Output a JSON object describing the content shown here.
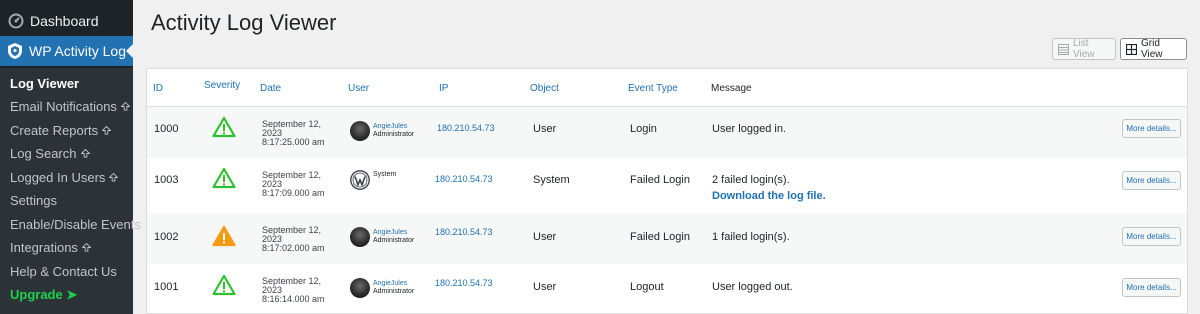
{
  "sidebar": {
    "dashboard_label": "Dashboard",
    "plugin_label": "WP Activity Log",
    "items": [
      {
        "label": "Log Viewer"
      },
      {
        "label": "Email Notifications"
      },
      {
        "label": "Create Reports"
      },
      {
        "label": "Log Search"
      },
      {
        "label": "Logged In Users"
      },
      {
        "label": "Settings"
      },
      {
        "label": "Enable/Disable Events"
      },
      {
        "label": "Integrations"
      },
      {
        "label": "Help & Contact Us"
      },
      {
        "label": "Upgrade ➤"
      }
    ]
  },
  "page": {
    "title": "Activity Log Viewer",
    "list_view_label": "List View",
    "grid_view_label": "Grid View"
  },
  "table": {
    "headers": [
      "ID",
      "Severity",
      "Date",
      "User",
      "IP",
      "Object",
      "Event Type",
      "Message"
    ],
    "more_label": "More details...",
    "rows": [
      {
        "id": "1000",
        "severity": "low",
        "date1": "September 12,",
        "date2": "2023",
        "time": "8:17:25.000 am",
        "user": "AngieJules",
        "role": "Administrator",
        "ip": "180.210.54.73",
        "object": "User",
        "event": "Login",
        "message": "User logged in.",
        "link": ""
      },
      {
        "id": "1003",
        "severity": "low",
        "date1": "September 12,",
        "date2": "2023",
        "time": "8:17:09.000 am",
        "user": "System",
        "role": "",
        "ip": "180.210.54.73",
        "object": "System",
        "event": "Failed Login",
        "message": "2 failed login(s).",
        "link": "Download the log file."
      },
      {
        "id": "1002",
        "severity": "medium",
        "date1": "September 12,",
        "date2": "2023",
        "time": "8:17:02.000 am",
        "user": "AngieJules",
        "role": "Administrator",
        "ip": "180.210.54.73",
        "object": "User",
        "event": "Failed Login",
        "message": "1 failed login(s).",
        "link": ""
      },
      {
        "id": "1001",
        "severity": "low",
        "date1": "September 12,",
        "date2": "2023",
        "time": "8:16:14.000 am",
        "user": "AngieJules",
        "role": "Administrator",
        "ip": "180.210.54.73",
        "object": "User",
        "event": "Logout",
        "message": "User logged out.",
        "link": ""
      }
    ]
  },
  "colors": {
    "sidebar_bg": "#1d2327",
    "active_blue": "#2271b1",
    "severity_low": "#2ec12e",
    "severity_medium": "#f39c12",
    "upgrade_green": "#1ed14b"
  }
}
